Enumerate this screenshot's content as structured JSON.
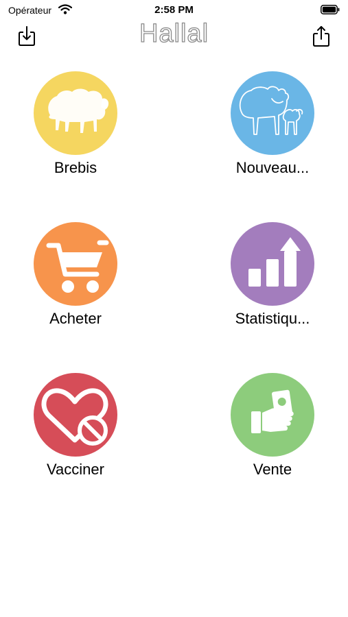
{
  "status_bar": {
    "carrier": "Opérateur",
    "time": "2:58 PM"
  },
  "nav": {
    "title": "Hallal",
    "left_icon": "download-tray-icon",
    "right_icon": "share-icon"
  },
  "menu": [
    {
      "label": "Brebis",
      "color": "#f5d660",
      "icon": "sheep-icon"
    },
    {
      "label": "Nouveau...",
      "color": "#6ab6e6",
      "icon": "sheep-and-lamb-icon"
    },
    {
      "label": "Acheter",
      "color": "#f7944c",
      "icon": "shopping-cart-icon"
    },
    {
      "label": "Statistiqu...",
      "color": "#a37dbd",
      "icon": "bar-chart-up-icon"
    },
    {
      "label": "Vacciner",
      "color": "#d64d58",
      "icon": "heart-forbidden-icon"
    },
    {
      "label": "Vente",
      "color": "#8dcc7c",
      "icon": "hand-money-icon"
    }
  ]
}
